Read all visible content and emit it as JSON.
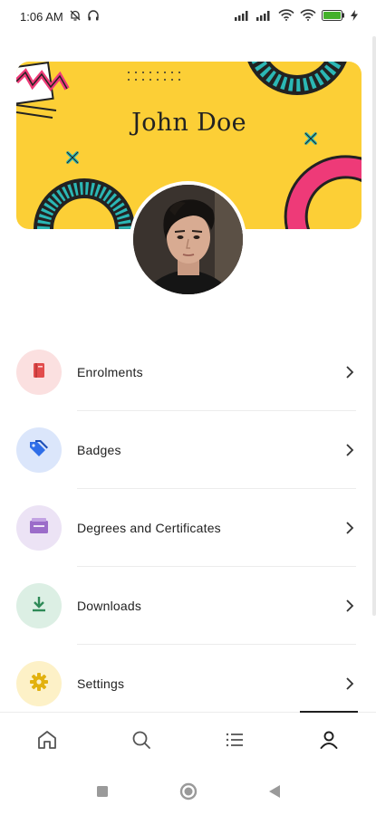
{
  "status_bar": {
    "time": "1:06 AM",
    "battery_color": "#43b02a"
  },
  "profile": {
    "name": "John Doe",
    "banner_color": "#fccf36",
    "accent_pink": "#ee3a78",
    "accent_teal": "#2bb7b5"
  },
  "menu": {
    "items": [
      {
        "label": "Enrolments",
        "icon": "book-icon",
        "bg": "#fbe0e0",
        "color": "#e24c4c"
      },
      {
        "label": "Badges",
        "icon": "tag-icon",
        "bg": "#dbe6fb",
        "color": "#2f6ee8"
      },
      {
        "label": "Degrees and Certificates",
        "icon": "certificate-icon",
        "bg": "#ece3f5",
        "color": "#9b6cc9"
      },
      {
        "label": "Downloads",
        "icon": "download-icon",
        "bg": "#dcefe4",
        "color": "#2e8a57"
      },
      {
        "label": "Settings",
        "icon": "gear-icon",
        "bg": "#fdf1c7",
        "color": "#e2b10f"
      }
    ]
  },
  "bottom_nav": {
    "tabs": [
      {
        "name": "home",
        "icon": "home-icon",
        "active": false
      },
      {
        "name": "search",
        "icon": "search-icon",
        "active": false
      },
      {
        "name": "list",
        "icon": "list-icon",
        "active": false
      },
      {
        "name": "profile",
        "icon": "profile-icon",
        "active": true
      }
    ]
  }
}
